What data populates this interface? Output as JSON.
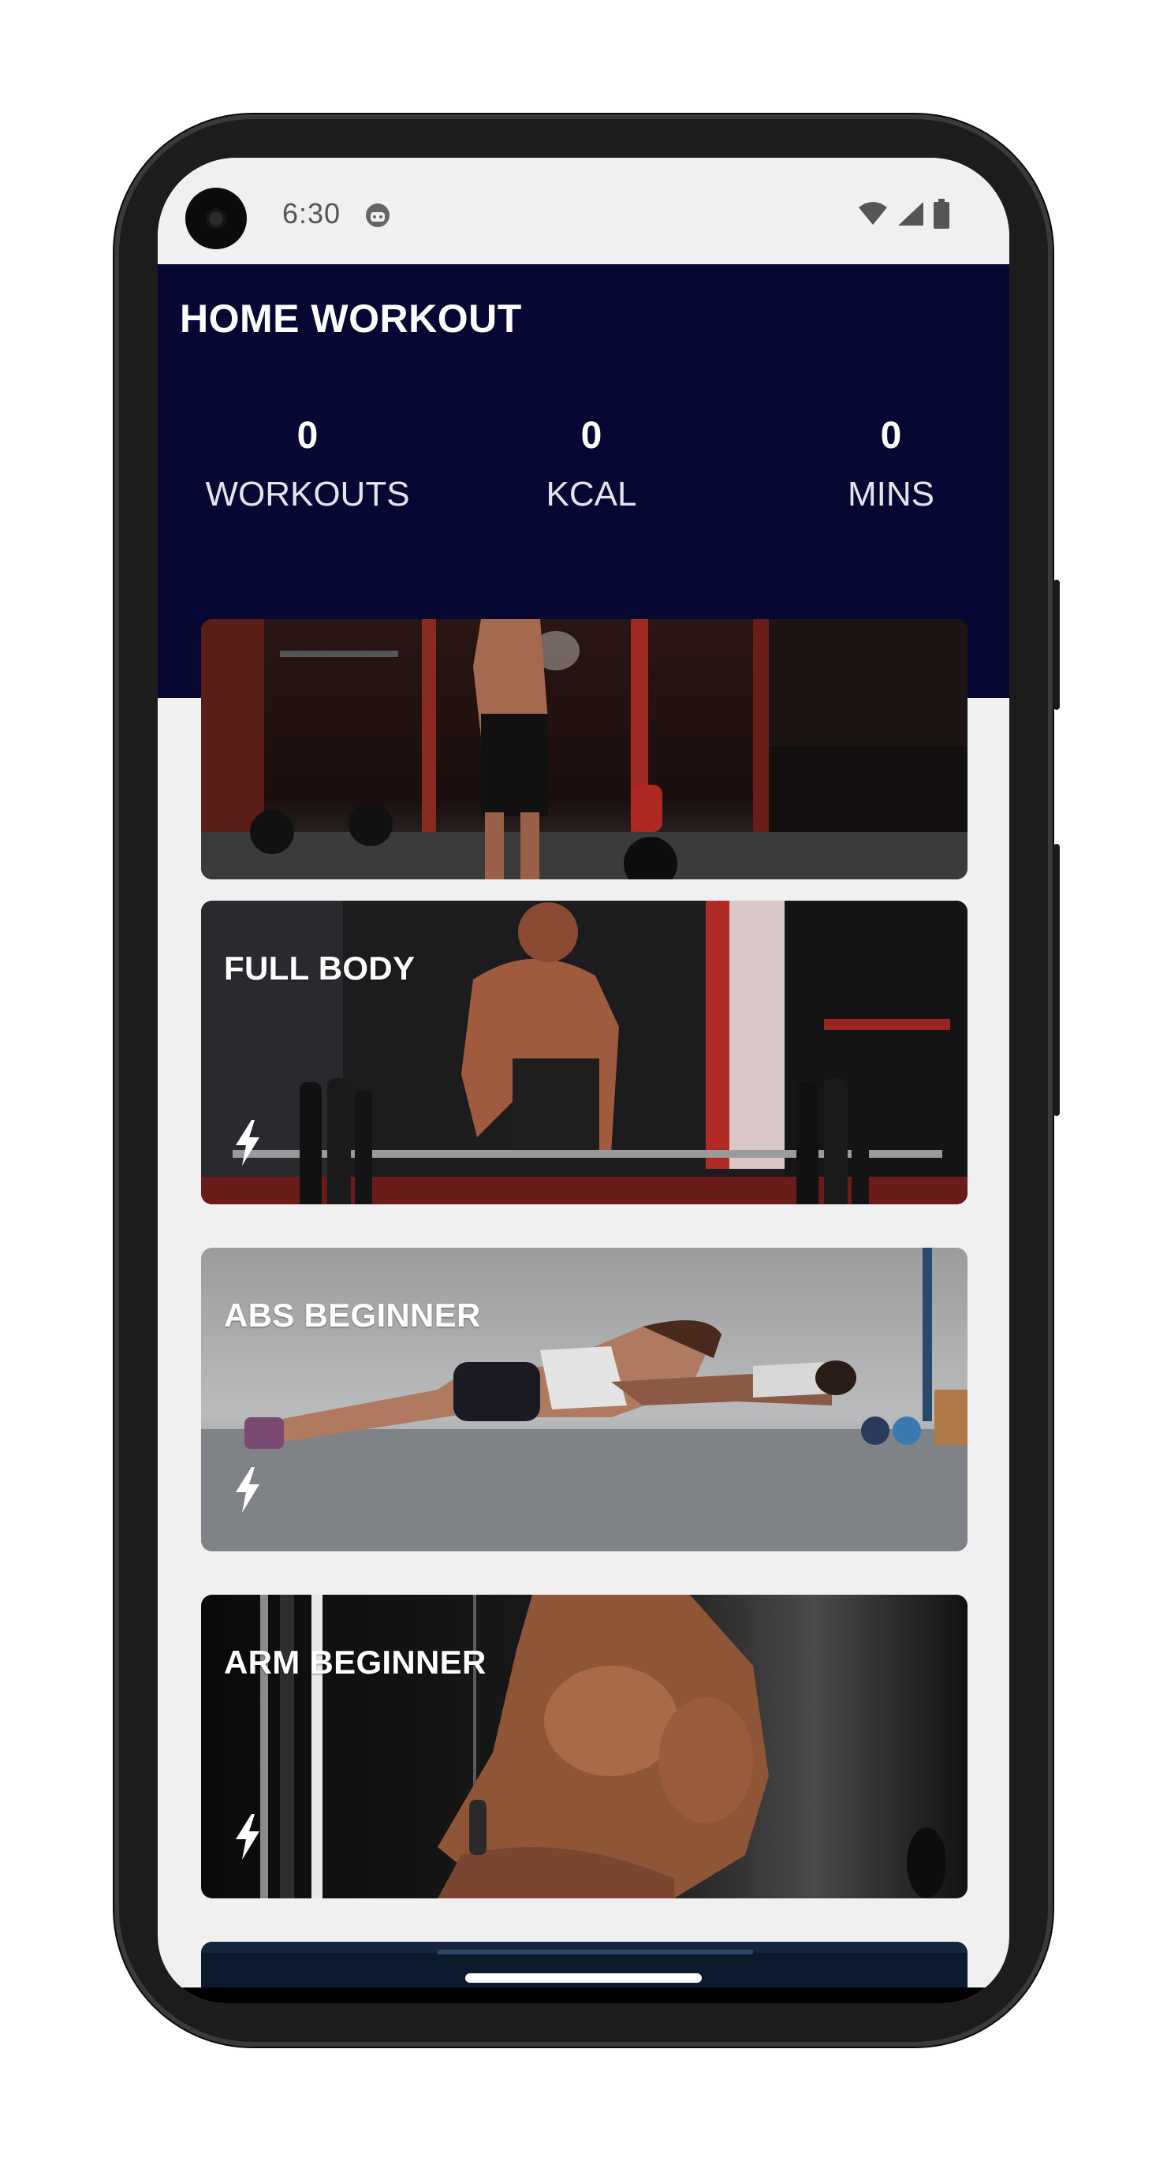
{
  "status_bar": {
    "time": "6:30",
    "icons": [
      "camera-hole",
      "android-face-icon",
      "wifi-icon",
      "signal-icon",
      "battery-icon"
    ]
  },
  "header": {
    "title": "HOME WORKOUT",
    "background": "#060833",
    "stats": [
      {
        "value": "0",
        "label": "WORKOUTS"
      },
      {
        "value": "0",
        "label": "KCAL"
      },
      {
        "value": "0",
        "label": "MINS"
      }
    ]
  },
  "workouts": [
    {
      "title": "FULL BODY",
      "icon": "bolt-icon"
    },
    {
      "title": "ABS BEGINNER",
      "icon": "bolt-icon"
    },
    {
      "title": "ARM BEGINNER",
      "icon": "bolt-icon"
    }
  ],
  "colors": {
    "screen_bg": "#f0f0f0",
    "card_text": "#ffffff"
  }
}
